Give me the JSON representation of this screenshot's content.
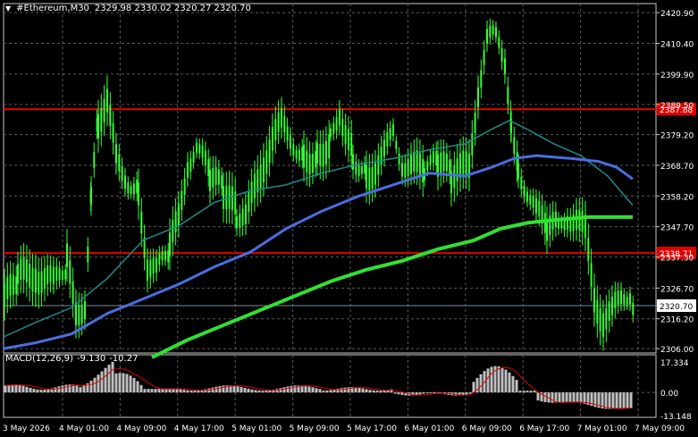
{
  "header": {
    "symbol": "#Ethereum,M30",
    "ohlc": "2329.98 2330.02 2320.27 2320.70",
    "menu_icon": "triangle-down-icon"
  },
  "main_chart": {
    "price_ticks": [
      "2420.90",
      "2410.40",
      "2399.90",
      "2389.50",
      "2379.20",
      "2368.70",
      "2358.20",
      "2347.70",
      "2337.30",
      "2326.70",
      "2316.20",
      "2306.00"
    ],
    "price_range": [
      2304.5,
      2424.0
    ],
    "horizontal_lines": [
      {
        "label": "2387.88",
        "value": 2387.88,
        "color": "#e00000"
      },
      {
        "label": "2338.71",
        "value": 2338.71,
        "color": "#e00000"
      }
    ],
    "current_price": {
      "label": "2320.70",
      "value": 2320.7
    },
    "colors": {
      "candles": "#32ff32",
      "ma_teal": "#1c8c8c",
      "ma_blue": "#4a6ee0",
      "ma_green": "#32e032",
      "grid": "#5a5a5a"
    }
  },
  "macd_panel": {
    "title": "MACD(12,26,9)",
    "main_value": "-9.130",
    "signal_value": "-10.27",
    "ticks": [
      "17.334",
      "0.00",
      "-13.148"
    ],
    "range": [
      -13.148,
      17.334
    ]
  },
  "time_axis": {
    "labels": [
      "3 May 2026",
      "4 May 01:00",
      "4 May 09:00",
      "4 May 17:00",
      "5 May 01:00",
      "5 May 09:00",
      "5 May 17:00",
      "6 May 01:00",
      "6 May 09:00",
      "6 May 17:00",
      "7 May 01:00",
      "7 May 09:00"
    ]
  }
}
